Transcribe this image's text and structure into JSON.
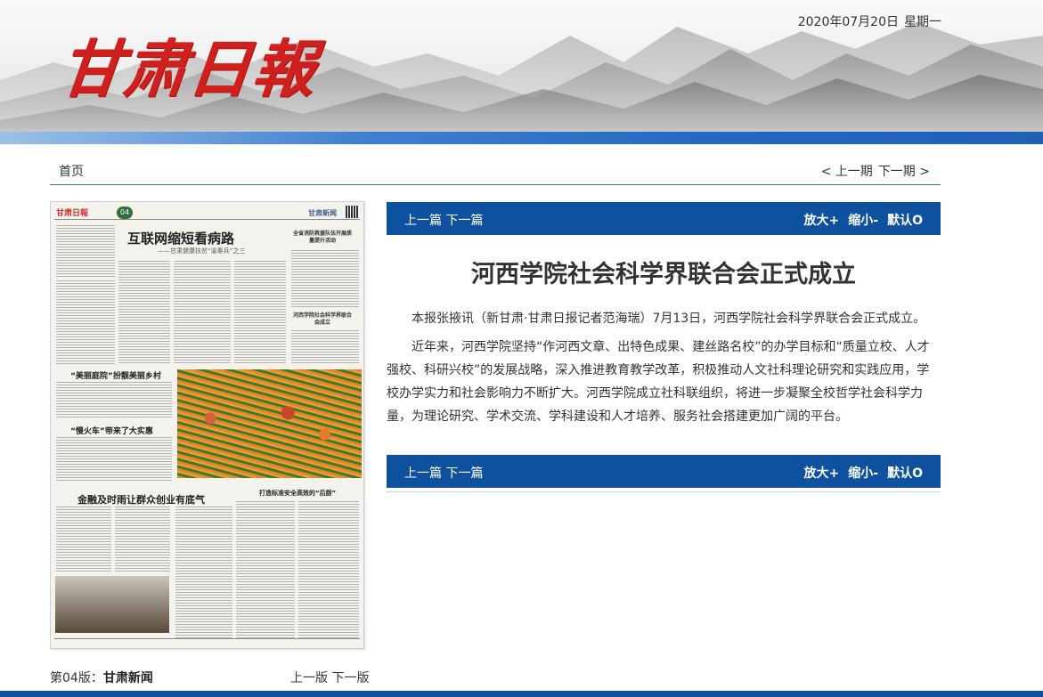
{
  "header": {
    "masthead": "甘肃日報",
    "date": "2020年07月20日",
    "weekday": "星期一"
  },
  "nav": {
    "home": "首页",
    "prev_issue": "< 上一期",
    "next_issue": "下一期 >"
  },
  "paper_thumbnail": {
    "logo": "甘肃日報",
    "page_number": "04",
    "section": "甘肃新闻",
    "headline_main": "互联网缩短看病路",
    "headline_main_sub": "——甘肃健康扶贫“渝秦兵”之三",
    "story_2_title": "“美丽庭院”扮靓美丽乡村",
    "story_3_title": "“慢火车”带来了大实惠",
    "story_4_title": "金融及时雨让群众创业有底气",
    "story_5_title": "打造标准安全高效的“后厨”",
    "side_head_1": "全省消防救援队伍开展质量提升活动",
    "side_head_2": "河西学院社会科学界联合会成立"
  },
  "edition": {
    "label": "第04版：",
    "name": "甘肃新闻",
    "prev": "上一版",
    "next": "下一版"
  },
  "toolbar": {
    "prev_article": "上一篇",
    "next_article": "下一篇",
    "zoom_in": "放大+",
    "zoom_out": "缩小-",
    "reset": "默认O"
  },
  "article": {
    "title": "河西学院社会科学界联合会正式成立",
    "paragraphs": [
      "本报张掖讯（新甘肃·甘肃日报记者范海瑞）7月13日，河西学院社会科学界联合会正式成立。",
      "近年来，河西学院坚持“作河西文章、出特色成果、建丝路名校”的办学目标和“质量立校、人才强校、科研兴校”的发展战略，深入推进教育教学改革，积极推动人文社科理论研究和实践应用，学校办学实力和社会影响力不断扩大。河西学院成立社科联组织，将进一步凝聚全校哲学社会科学力量，为理论研究、学术交流、学科建设和人才培养、服务社会搭建更加广阔的平台。"
    ]
  },
  "colors": {
    "brand_red": "#d0201d",
    "toolbar_blue": "#0e519e",
    "nav_line": "#3b6aa3"
  }
}
